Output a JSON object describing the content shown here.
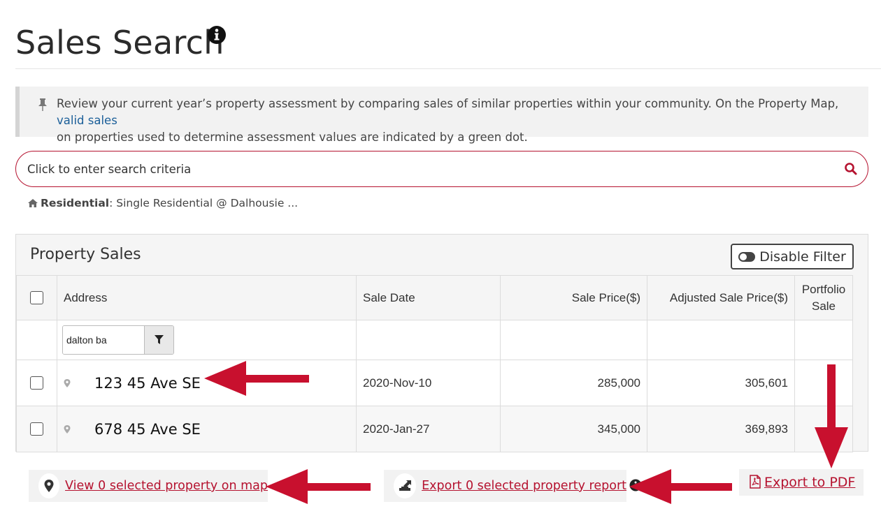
{
  "page": {
    "title": "Sales Search"
  },
  "notice": {
    "text_before": "Review your current year’s property assessment by comparing sales of similar properties within your community. On the Property Map,",
    "link": "valid sales",
    "text_after": "on properties used to determine assessment values are indicated by a green dot."
  },
  "search": {
    "placeholder": "Click to enter search criteria"
  },
  "criteria": {
    "label": "Residential",
    "value": ": Single Residential @ Dalhousie ..."
  },
  "panel": {
    "title": "Property Sales",
    "disable_filter_label": "Disable Filter"
  },
  "table": {
    "columns": {
      "address": "Address",
      "sale_date": "Sale Date",
      "sale_price": "Sale Price($)",
      "adjusted_sale_price": "Adjusted Sale Price($)",
      "portfolio_line1": "Portfolio",
      "portfolio_line2": "Sale"
    },
    "address_filter_value": "dalton ba",
    "rows": [
      {
        "address": "123 45 Ave SE",
        "sale_date": "2020-Nov-10",
        "sale_price": "285,000",
        "adjusted_sale_price": "305,601",
        "portfolio": ""
      },
      {
        "address": "678 45 Ave SE",
        "sale_date": "2020-Jan-27",
        "sale_price": "345,000",
        "adjusted_sale_price": "369,893",
        "portfolio": ""
      }
    ]
  },
  "actions": {
    "view_map": "View 0 selected property on map",
    "export_report": "Export 0 selected property report",
    "export_pdf": "Export to PDF"
  },
  "colors": {
    "accent": "#b5122f",
    "link": "#1b5f99",
    "annotation_arrow": "#c8102e"
  },
  "icons": {
    "info": "info-circle-icon",
    "pin": "thumbtack-icon",
    "search": "search-icon",
    "home": "home-icon",
    "toggle": "toggle-on-icon",
    "filter": "filter-funnel-icon",
    "marker": "map-marker-icon",
    "export": "export-icon",
    "pdf": "file-pdf-icon"
  }
}
